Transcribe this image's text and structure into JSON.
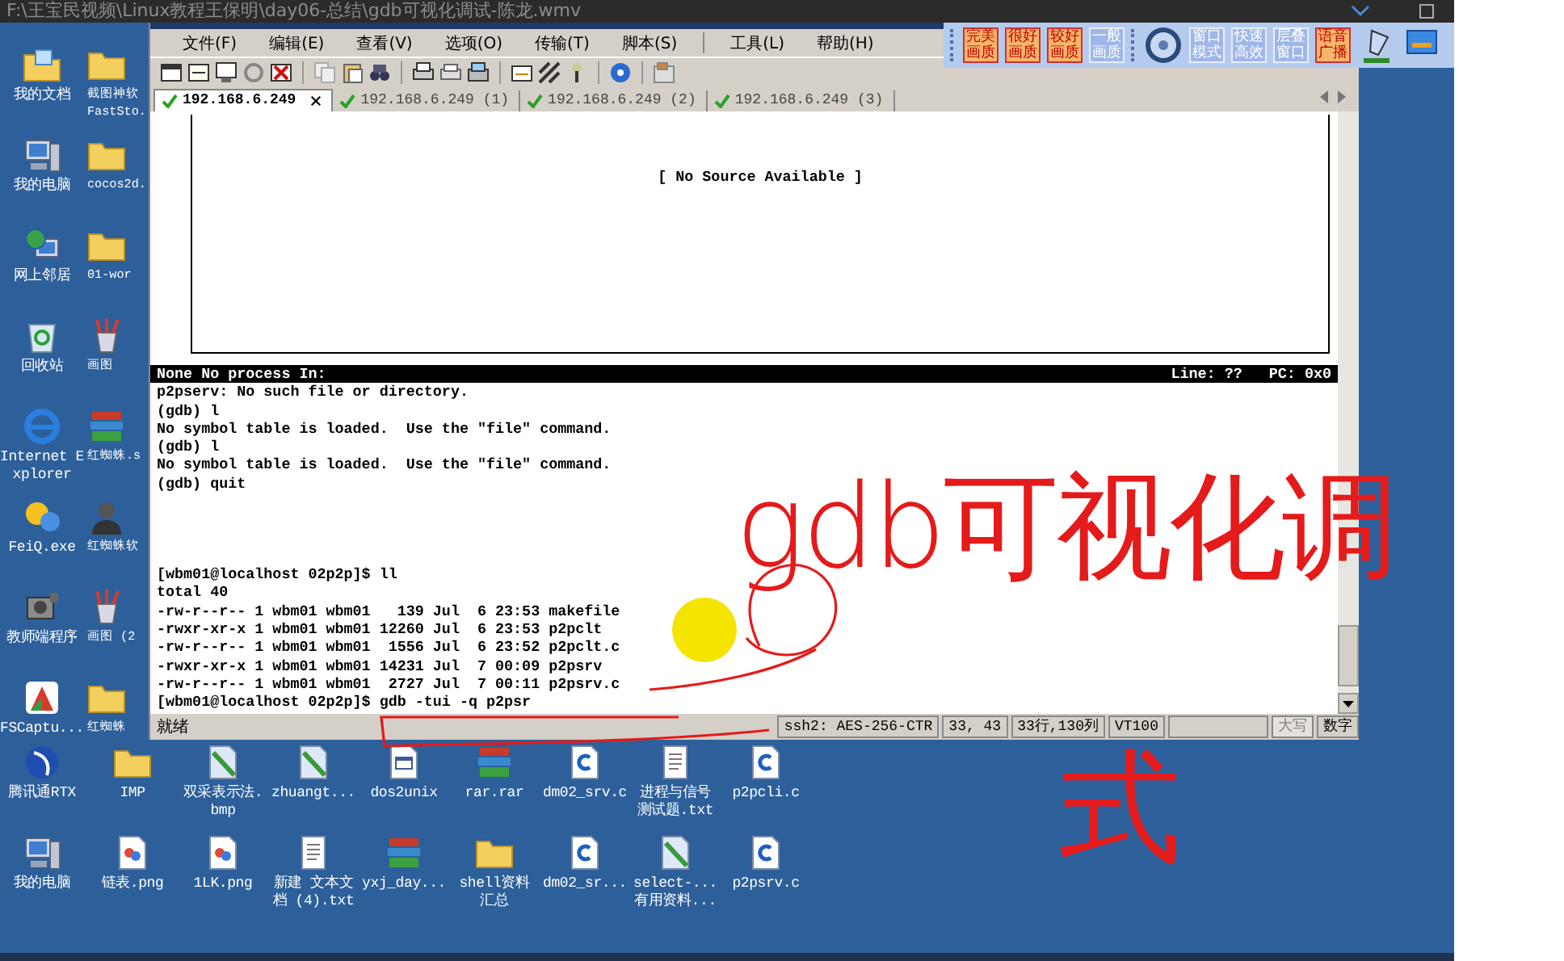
{
  "player": {
    "title": "F:\\王宝民视频\\Linux教程王保明\\day06-总结\\gdb可视化调试-陈龙.wmv"
  },
  "desktop": {
    "column_1": [
      {
        "label": "我的文档",
        "kind": "documents"
      },
      {
        "label": "我的电脑",
        "kind": "computer"
      },
      {
        "label": "网上邻居",
        "kind": "network"
      },
      {
        "label": "回收站",
        "kind": "recycle"
      },
      {
        "label": "Internet Explorer",
        "kind": "ie"
      },
      {
        "label": "FeiQ.exe",
        "kind": "chat"
      },
      {
        "label": "教师端程序",
        "kind": "camera"
      },
      {
        "label": "FSCaptu...",
        "kind": "capture"
      }
    ],
    "column_2": [
      {
        "label": "截图神软 FastSto.",
        "kind": "folder"
      },
      {
        "label": "cocos2d.",
        "kind": "folder"
      },
      {
        "label": "01-wor",
        "kind": "folder"
      },
      {
        "label": "画图",
        "kind": "paint"
      },
      {
        "label": "红蜘蛛.s",
        "kind": "archive"
      },
      {
        "label": "红蜘蛛软",
        "kind": "portrait"
      },
      {
        "label": "画图 (2",
        "kind": "paint"
      },
      {
        "label": "红蜘蛛",
        "kind": "folder"
      }
    ],
    "bottom_row_1": [
      {
        "label": "腾讯通RTX",
        "kind": "rtx"
      },
      {
        "label": "IMP",
        "kind": "folder"
      },
      {
        "label": "双采表示法.bmp",
        "kind": "bmp"
      },
      {
        "label": "zhuangt...",
        "kind": "bmp"
      },
      {
        "label": "dos2unix",
        "kind": "window-file"
      },
      {
        "label": "rar.rar",
        "kind": "archive"
      },
      {
        "label": "dm02_srv.c",
        "kind": "c"
      },
      {
        "label": "进程与信号测试题.txt",
        "kind": "txt"
      },
      {
        "label": "p2pcli.c",
        "kind": "c"
      }
    ],
    "bottom_row_2": [
      {
        "label": "我的电脑",
        "kind": "computer"
      },
      {
        "label": "链表.png",
        "kind": "png"
      },
      {
        "label": "1LK.png",
        "kind": "png"
      },
      {
        "label": "新建 文本文档 (4).txt",
        "kind": "txt"
      },
      {
        "label": "yxj_day...",
        "kind": "archive"
      },
      {
        "label": "shell资料汇总",
        "kind": "folder"
      },
      {
        "label": "dm02_sr...",
        "kind": "c"
      },
      {
        "label": "select-...有用资料...",
        "kind": "bmp"
      },
      {
        "label": "p2psrv.c",
        "kind": "c"
      }
    ]
  },
  "remote_toolbar": {
    "buttons": [
      {
        "label": "完美画质",
        "kind": "warm"
      },
      {
        "label": "很好画质",
        "kind": "warm"
      },
      {
        "label": "较好画质",
        "kind": "warm"
      },
      {
        "label": "一般画质",
        "kind": "plain"
      },
      {
        "kind": "disc"
      },
      {
        "label": "窗口模式",
        "kind": "plain"
      },
      {
        "label": "快速高效",
        "kind": "plain"
      },
      {
        "label": "层叠窗口",
        "kind": "plain"
      },
      {
        "label": "语音广播",
        "kind": "warm"
      },
      {
        "kind": "pen"
      },
      {
        "kind": "monitor"
      }
    ]
  },
  "terminal_window": {
    "menu": [
      [
        "文件(F)",
        "编辑(E)",
        "查看(V)",
        "选项(O)",
        "传输(T)",
        "脚本(S)"
      ],
      [
        "工具(L)",
        "帮助(H)"
      ]
    ],
    "tabs": [
      {
        "label": "192.168.6.249",
        "selected": true
      },
      {
        "label": "192.168.6.249 (1)",
        "selected": false
      },
      {
        "label": "192.168.6.249 (2)",
        "selected": false
      },
      {
        "label": "192.168.6.249 (3)",
        "selected": false
      }
    ],
    "tui": {
      "source_message": "[ No Source Available ]",
      "status_left": "None No process In:",
      "status_right": "Line: ??   PC: 0x0"
    },
    "gdb_output": [
      "p2pserv: No such file or directory.",
      "(gdb) l",
      "No symbol table is loaded.  Use the \"file\" command.",
      "(gdb) l",
      "No symbol table is loaded.  Use the \"file\" command.",
      "(gdb) quit"
    ],
    "shell_output": [
      "[wbm01@localhost 02p2p]$ ll",
      "total 40",
      "-rw-r--r-- 1 wbm01 wbm01   139 Jul  6 23:53 makefile",
      "-rwxr-xr-x 1 wbm01 wbm01 12260 Jul  6 23:53 **p2pclt**",
      "-rw-r--r-- 1 wbm01 wbm01  1556 Jul  6 23:52 p2pclt.c",
      "-rwxr-xr-x 1 wbm01 wbm01 14231 Jul  7 00:09 **p2psrv**",
      "-rw-r--r-- 1 wbm01 wbm01  2727 Jul  7 00:11 p2psrv.c",
      "[wbm01@localhost 02p2p]$ gdb -tui -q p2psr"
    ],
    "status_bar": [
      {
        "kind": "state",
        "text": "就绪"
      },
      {
        "kind": "panel",
        "text": "ssh2: AES-256-CTR",
        "disabled": false
      },
      {
        "kind": "panel",
        "text": "33,  43",
        "disabled": false
      },
      {
        "kind": "panel",
        "text": "33行,130列",
        "disabled": false
      },
      {
        "kind": "panel",
        "text": "VT100",
        "disabled": false
      },
      {
        "kind": "empty"
      },
      {
        "kind": "panel",
        "text": "大写",
        "disabled": true
      },
      {
        "kind": "panel",
        "text": "数字",
        "disabled": false
      }
    ]
  },
  "annotation": {
    "lines": [
      "gdb可视化调",
      "式"
    ]
  }
}
